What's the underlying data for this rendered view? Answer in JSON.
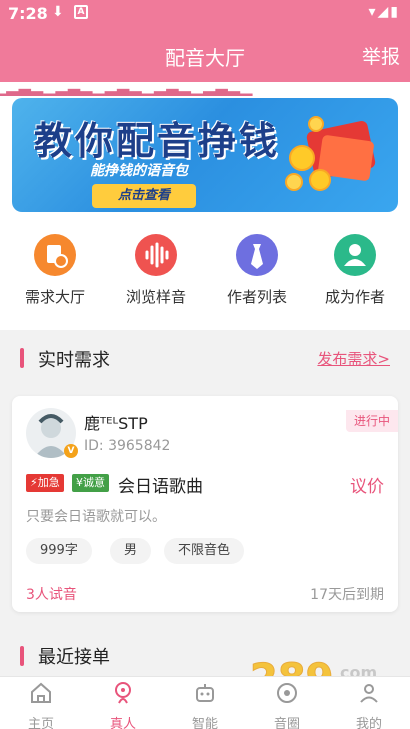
{
  "statusbar": {
    "time": "7:28"
  },
  "header": {
    "title": "配音大厅",
    "report": "举报"
  },
  "banner": {
    "headline": "教你配音挣钱",
    "subline": "能挣钱的语音包",
    "cta": "点击查看"
  },
  "quick_actions": [
    {
      "label": "需求大厅",
      "color": "#f6882e"
    },
    {
      "label": "浏览样音",
      "color": "#ef5350"
    },
    {
      "label": "作者列表",
      "color": "#6e6fe0"
    },
    {
      "label": "成为作者",
      "color": "#2bb98a"
    }
  ],
  "realtime": {
    "title": "实时需求",
    "link": "发布需求>"
  },
  "demand_card": {
    "name": "鹿ᵀᴱᴸSTP",
    "user_id": "ID: 3965842",
    "status": "进行中",
    "tags": [
      {
        "label": "⚡加急",
        "color": "#e53935"
      },
      {
        "label": "¥诚意",
        "color": "#43a047"
      }
    ],
    "title": "会日语歌曲",
    "price": "议价",
    "description": "只要会日语歌就可以。",
    "chips": [
      "999字",
      "男",
      "不限音色"
    ],
    "tries": "3人试音",
    "deadline": "17天后到期"
  },
  "recent": {
    "title": "最近接单"
  },
  "bottom_nav": [
    {
      "label": "主页",
      "icon": "home-icon",
      "active": false
    },
    {
      "label": "真人",
      "icon": "person-icon",
      "active": true
    },
    {
      "label": "智能",
      "icon": "robot-icon",
      "active": false
    },
    {
      "label": "音圈",
      "icon": "circle-icon",
      "active": false
    },
    {
      "label": "我的",
      "icon": "user-icon",
      "active": false
    }
  ],
  "colors": {
    "brand": "#f07a9a",
    "accent": "#e8547b"
  }
}
